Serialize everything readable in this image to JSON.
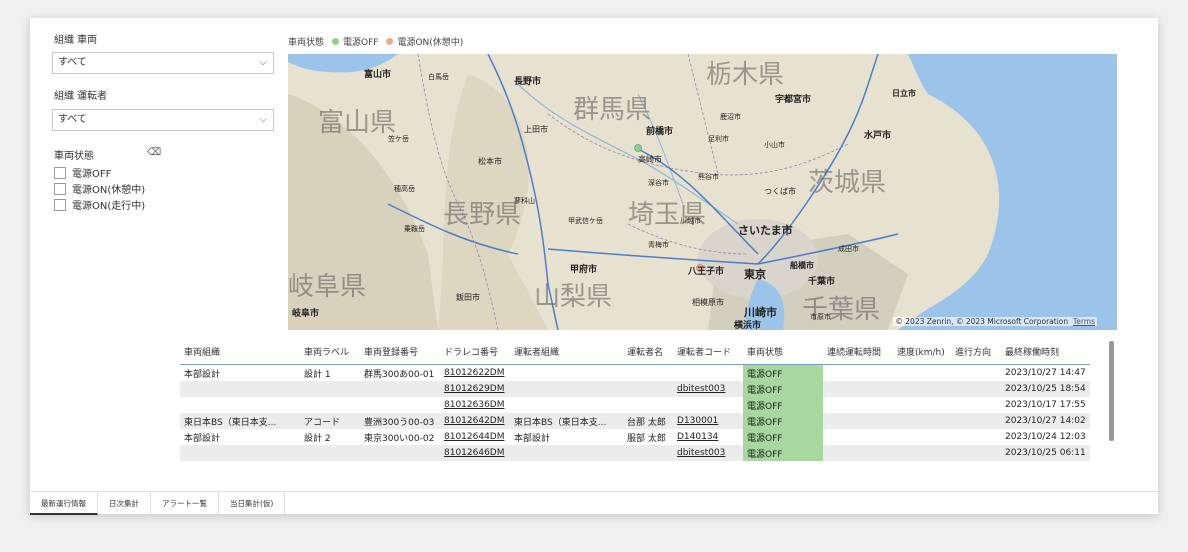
{
  "filters": {
    "org_vehicle": {
      "title": "組織 車両",
      "value": "すべて"
    },
    "org_driver": {
      "title": "組織 運転者",
      "value": "すべて"
    },
    "vehicle_state": {
      "title": "車両状態",
      "options": [
        "電源OFF",
        "電源ON(休憩中)",
        "電源ON(走行中)"
      ]
    }
  },
  "map": {
    "legend_title": "車両状態",
    "legend": [
      {
        "label": "電源OFF",
        "color": "#8fcf8a"
      },
      {
        "label": "電源ON(休憩中)",
        "color": "#f0a890"
      }
    ],
    "prefectures": [
      "栃木県",
      "富山県",
      "群馬県",
      "茨城県",
      "長野県",
      "埼玉県",
      "岐阜県",
      "山梨県",
      "千葉県"
    ],
    "cities": [
      "富山市",
      "長野市",
      "白馬岳",
      "宇都宮市",
      "日立市",
      "上田市",
      "前橋市",
      "水戸市",
      "松本市",
      "高崎市",
      "つくば市",
      "さいたま市",
      "甲府市",
      "八王子市",
      "東京",
      "船橋市",
      "千葉市",
      "岐阜市",
      "飯田市",
      "川崎市",
      "横浜市",
      "鹿沼市",
      "足利市",
      "小山市",
      "深谷市",
      "熊谷市",
      "川越市",
      "青梅市",
      "成田市",
      "相模原市",
      "市原市",
      "穂高岳",
      "乗鞍岳",
      "蓼科山",
      "甲武信ケ岳",
      "笠ケ岳"
    ],
    "copyright": "© 2023 Zenrin, © 2023 Microsoft Corporation",
    "terms": "Terms"
  },
  "table": {
    "headers": [
      "車両組織",
      "車両ラベル",
      "車両登録番号",
      "ドラレコ番号",
      "運転者組織",
      "運転者名",
      "運転者コード",
      "車両状態",
      "連続運転時間",
      "速度(km/h)",
      "進行方向",
      "最終稼働時刻"
    ],
    "rows": [
      [
        "本部設計",
        "設計 1",
        "群馬300あ00-01",
        "81012622DM",
        "",
        "",
        "",
        "電源OFF",
        "",
        "",
        "",
        "2023/10/27 14:47"
      ],
      [
        "",
        "",
        "",
        "81012629DM",
        "",
        "",
        "dbitest003",
        "電源OFF",
        "",
        "",
        "",
        "2023/10/25 18:54"
      ],
      [
        "",
        "",
        "",
        "81012636DM",
        "",
        "",
        "",
        "電源OFF",
        "",
        "",
        "",
        "2023/10/17 17:55"
      ],
      [
        "東日本BS（東日本支...",
        "アコード",
        "豊洲300う00-03",
        "81012642DM",
        "東日本BS（東日本支...",
        "台那 太郎",
        "D130001",
        "電源OFF",
        "",
        "",
        "",
        "2023/10/27 14:02"
      ],
      [
        "本部設計",
        "設計 2",
        "東京300い00-02",
        "81012644DM",
        "本部設計",
        "服部 太郎",
        "D140134",
        "電源OFF",
        "",
        "",
        "",
        "2023/10/24 12:03"
      ],
      [
        "",
        "",
        "",
        "81012646DM",
        "",
        "",
        "dbitest003",
        "電源OFF",
        "",
        "",
        "",
        "2023/10/25 06:11"
      ]
    ]
  },
  "tabs": [
    "最新運行情報",
    "日次集計",
    "アラート一覧",
    "当日集計(仮)"
  ],
  "colors": {
    "status_off": "#a8d8a0",
    "sea": "#9cc4ea",
    "land": "#e4dfce"
  }
}
